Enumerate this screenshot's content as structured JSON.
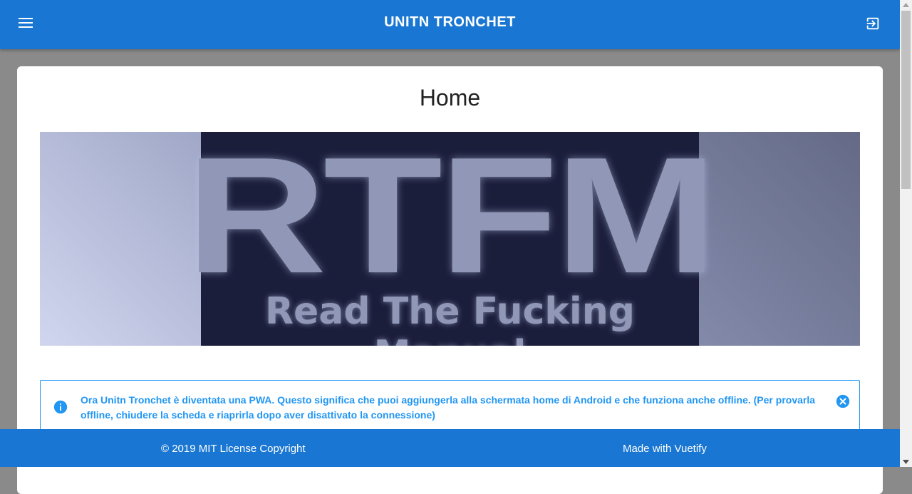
{
  "header": {
    "title": "UNITN TRONCHET",
    "menu_icon": "menu-icon",
    "logout_icon": "logout-icon"
  },
  "main": {
    "page_title": "Home",
    "banner": {
      "big_text": "RTFM",
      "sub_text": "Read The Fucking Manual"
    },
    "alert": {
      "text": "Ora Unitn Tronchet è diventata una PWA. Questo significa che puoi aggiungerla alla schermata home di Android e che funziona anche offline. (Per provarla offline, chiudere la scheda e riaprirla dopo aver disattivato la connessione)",
      "info_icon": "info-icon",
      "close_icon": "close-icon"
    }
  },
  "footer": {
    "left_text": "© 2019 MIT License Copyright",
    "right_text": "Made with Vuetify"
  },
  "colors": {
    "primary": "#1976d2",
    "info": "#2196f3"
  }
}
